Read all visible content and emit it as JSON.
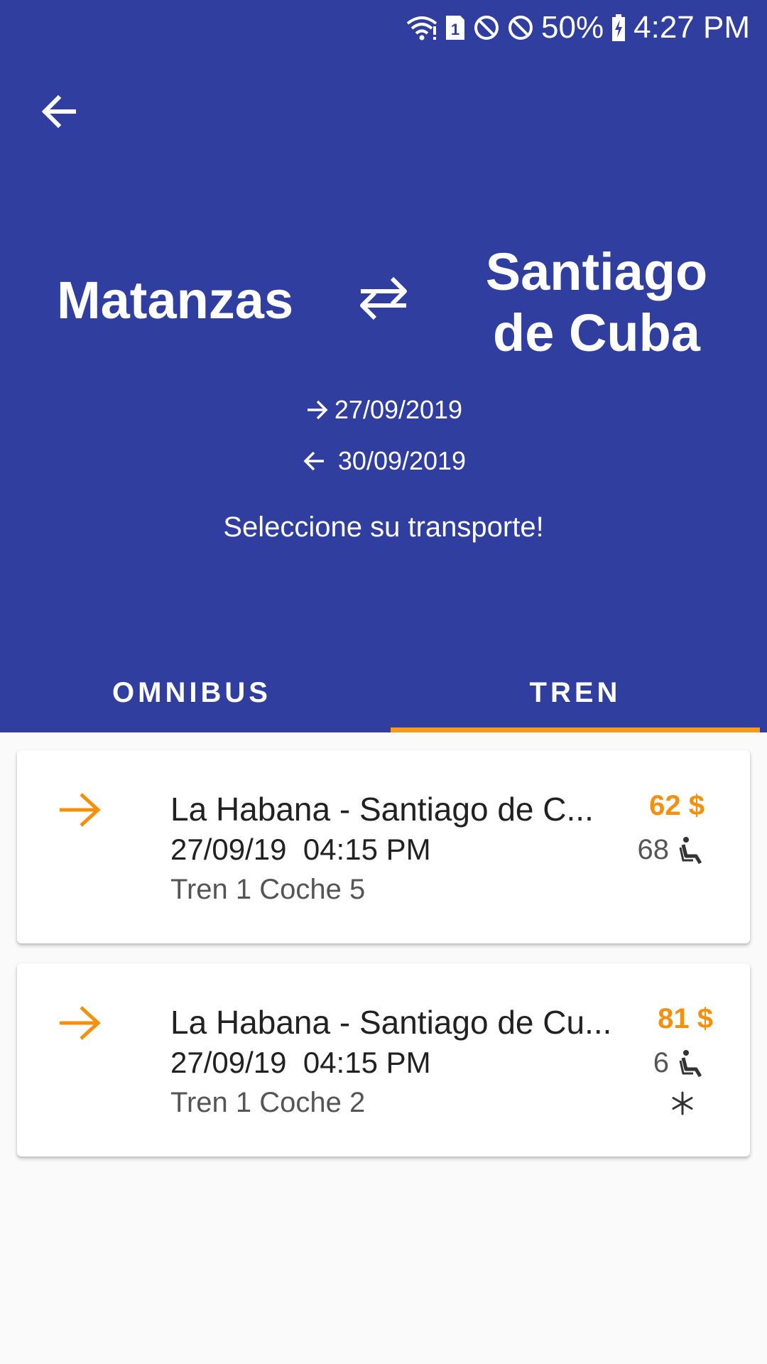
{
  "status_bar": {
    "battery_percent": "50%",
    "time": "4:27 PM",
    "sim_slot": "1",
    "icons": [
      "wifi-icon",
      "sim-icon",
      "do-not-disturb-icon",
      "blocked-icon",
      "battery-charging-icon"
    ]
  },
  "header": {
    "back_icon": "arrow-left-icon",
    "origin": "Matanzas",
    "destination_line1": "Santiago",
    "destination_line2": "de Cuba",
    "swap_icon": "swap-arrows-icon",
    "departure_date": "27/09/2019",
    "return_date": "30/09/2019",
    "prompt": "Seleccione su transporte!",
    "background_color": "#303f9f"
  },
  "tabs": [
    {
      "label": "OMNIBUS",
      "active": false
    },
    {
      "label": "TREN",
      "active": true
    }
  ],
  "accent_color": "#f59b1c",
  "results": [
    {
      "route": "La Habana - Santiago de C...",
      "date": "27/09/19",
      "time": "04:15 PM",
      "train_car": "Tren 1 Coche 5",
      "price": "62 $",
      "seats": "68",
      "air_conditioned": false
    },
    {
      "route": "La Habana - Santiago de Cu...",
      "date": "27/09/19",
      "time": "04:15 PM",
      "train_car": "Tren 1 Coche 2",
      "price": "81 $",
      "seats": "6",
      "air_conditioned": true
    }
  ]
}
